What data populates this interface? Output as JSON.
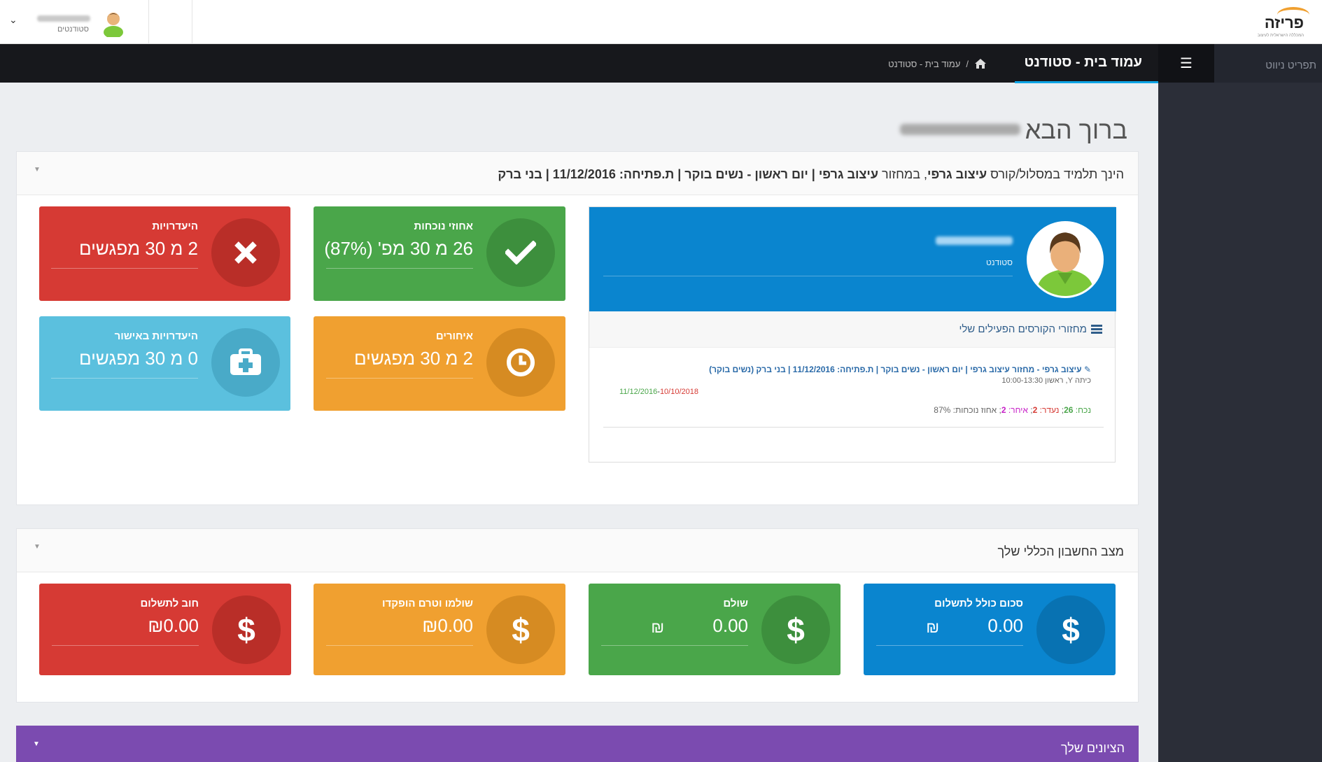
{
  "header": {
    "logo_text": "פריזה",
    "logo_sub": "המכללה הישראלית לעיצוב",
    "user_role": "סטודנטים"
  },
  "sidebar": {
    "title": "תפריט ניווט"
  },
  "titlebar": {
    "title": "עמוד בית - סטודנט",
    "breadcrumb": "עמוד בית - סטודנט",
    "breadcrumb_sep": "/"
  },
  "welcome": "ברוך הבא",
  "info_panel": {
    "text_prefix": "הינך תלמיד במסלול/קורס ",
    "course_name": "עיצוב גרפי",
    "text_mid": ", במחזור ",
    "cycle_name": "עיצוב גרפי",
    "details": " | יום ראשון - נשים בוקר | ת.פתיחה: 11/12/2016 | בני ברק"
  },
  "profile": {
    "role": "סטודנט",
    "courses_title": "מחזורי הקורסים הפעילים שלי",
    "course_link": "עיצוב גרפי - מחזור עיצוב גרפי | יום ראשון - נשים בוקר | ת.פתיחה: 11/12/2016 | בני ברק (נשים בוקר)",
    "course_schedule": "כיתה Y, ראשון 10:00-13:30",
    "date_start": "11/12/2016",
    "date_end": "10/10/2018",
    "stats": {
      "present_label": "נכח:",
      "present": "26",
      "absent_label": "נעדר:",
      "absent": "2",
      "late_label": "איחר:",
      "late": "2",
      "pct_label": "אחוז נוכחות:",
      "pct": "87%"
    }
  },
  "attendance_tiles": [
    {
      "label": "אחוזי נוכחות",
      "value": "26 מ 30 מפ' (87%)",
      "color": "#4aa64a"
    },
    {
      "label": "היעדרויות",
      "value": "2 מ 30 מפגשים",
      "color": "#d63a34"
    },
    {
      "label": "איחורים",
      "value": "2 מ 30 מפגשים",
      "color": "#f0a030"
    },
    {
      "label": "היעדרויות באישור",
      "value": "0 מ 30 מפגשים",
      "color": "#5bc0de"
    }
  ],
  "account_panel": {
    "title": "מצב החשבון הכללי שלך",
    "tiles": [
      {
        "label": "סכום כולל לתשלום",
        "value": "0.00",
        "currency": "₪",
        "color": "#0a85cf"
      },
      {
        "label": "שולם",
        "value": "0.00",
        "currency": "₪",
        "color": "#4aa64a"
      },
      {
        "label": "שולמו וטרם הופקדו",
        "value": "₪0.00",
        "color": "#f0a030"
      },
      {
        "label": "חוב לתשלום",
        "value": "₪0.00",
        "color": "#d63a34"
      }
    ]
  },
  "grades_panel": {
    "title": "הציונים שלך"
  }
}
